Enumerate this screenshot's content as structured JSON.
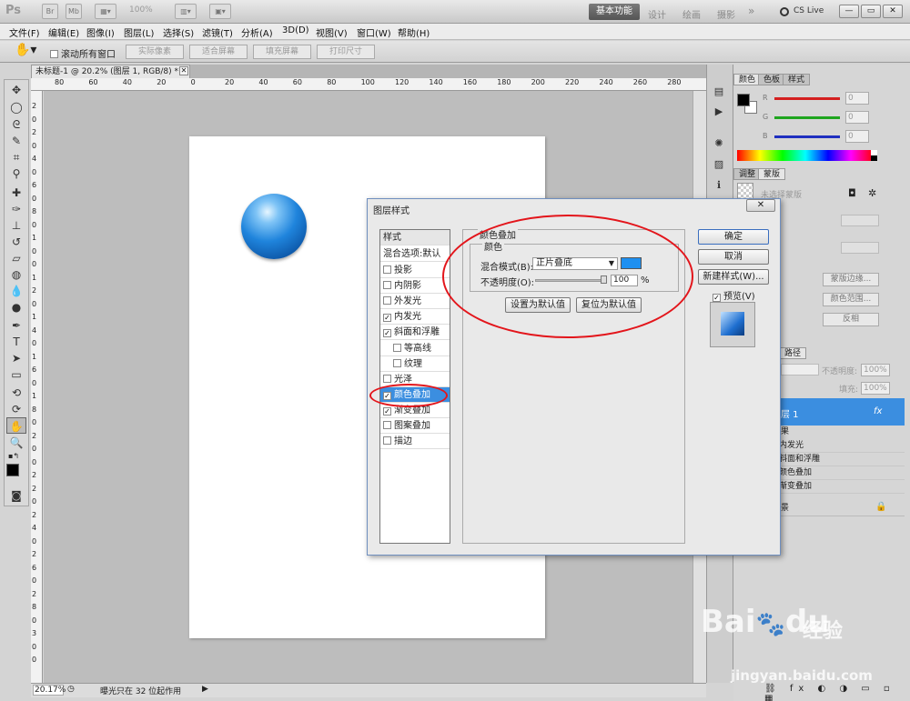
{
  "app": {
    "logo": "Ps",
    "bridge_icon": "Br",
    "minibridge_icon": "Mb",
    "zoom": "100%",
    "workspaces": [
      "基本功能",
      "设计",
      "绘画",
      "摄影"
    ],
    "more": "»",
    "cs_live": "CS Live",
    "window_buttons": [
      "—",
      "▭",
      "✕"
    ]
  },
  "menu": [
    "文件(F)",
    "编辑(E)",
    "图像(I)",
    "图层(L)",
    "选择(S)",
    "滤镜(T)",
    "分析(A)",
    "3D(D)",
    "视图(V)",
    "窗口(W)",
    "帮助(H)"
  ],
  "options_bar": {
    "scroll_all": "滚动所有窗口",
    "buttons": [
      "实际像素",
      "适合屏幕",
      "填充屏幕",
      "打印尺寸"
    ]
  },
  "document": {
    "tab_title": "未标题-1 @ 20.2% (图层 1, RGB/8) *",
    "ruler_top": [
      "80",
      "60",
      "40",
      "20",
      "0",
      "20",
      "40",
      "60",
      "80",
      "100",
      "120",
      "140",
      "160",
      "180",
      "200",
      "220",
      "240",
      "260",
      "280"
    ],
    "ruler_left": [
      "2",
      "0",
      "2",
      "0",
      "4",
      "0",
      "6",
      "0",
      "8",
      "0",
      "1",
      "0",
      "0",
      "1",
      "2",
      "0",
      "1",
      "4",
      "0",
      "1",
      "6",
      "0",
      "1",
      "8",
      "0",
      "2",
      "0",
      "0",
      "2",
      "2",
      "0",
      "2",
      "4",
      "0",
      "2",
      "6",
      "0",
      "2",
      "8",
      "0",
      "3",
      "0",
      "0"
    ]
  },
  "status": {
    "zoom": "20.17%",
    "info": "曝光只在 32 位起作用"
  },
  "color_panel": {
    "tabs": [
      "颜色",
      "色板",
      "样式"
    ],
    "channels": [
      {
        "label": "R",
        "value": "0",
        "color": "#d42020"
      },
      {
        "label": "G",
        "value": "0",
        "color": "#1fa51f"
      },
      {
        "label": "B",
        "value": "0",
        "color": "#1f2fbf"
      }
    ]
  },
  "adjust_panel": {
    "tabs": [
      "调整",
      "蒙版"
    ],
    "no_mask": "未选择蒙版",
    "buttons": [
      "蒙版边缘...",
      "颜色范围...",
      "反相"
    ]
  },
  "layers_panel": {
    "tab": "路径",
    "opacity_label": "不透明度:",
    "opacity_value": "100%",
    "fill_label": "填充:",
    "fill_value": "100%",
    "selected_layer": "层 1",
    "fx": "fx",
    "effects_label": "果",
    "effects": [
      "内发光",
      "斜面和浮雕",
      "颜色叠加",
      "渐变叠加"
    ],
    "background": "景"
  },
  "dialog": {
    "title": "图层样式",
    "close": "✕",
    "styles_header": "样式",
    "blend_default": "混合选项:默认",
    "items": [
      {
        "label": "投影",
        "checked": false,
        "sub": false,
        "selected": false
      },
      {
        "label": "内阴影",
        "checked": false,
        "sub": false,
        "selected": false
      },
      {
        "label": "外发光",
        "checked": false,
        "sub": false,
        "selected": false
      },
      {
        "label": "内发光",
        "checked": true,
        "sub": false,
        "selected": false
      },
      {
        "label": "斜面和浮雕",
        "checked": true,
        "sub": false,
        "selected": false
      },
      {
        "label": "等高线",
        "checked": false,
        "sub": true,
        "selected": false
      },
      {
        "label": "纹理",
        "checked": false,
        "sub": true,
        "selected": false
      },
      {
        "label": "光泽",
        "checked": false,
        "sub": false,
        "selected": false
      },
      {
        "label": "颜色叠加",
        "checked": true,
        "sub": false,
        "selected": true
      },
      {
        "label": "渐变叠加",
        "checked": true,
        "sub": false,
        "selected": false
      },
      {
        "label": "图案叠加",
        "checked": false,
        "sub": false,
        "selected": false
      },
      {
        "label": "描边",
        "checked": false,
        "sub": false,
        "selected": false
      }
    ],
    "section_title": "颜色叠加",
    "group_title": "颜色",
    "blend_mode_label": "混合模式(B):",
    "blend_mode_value": "正片叠底",
    "overlay_color": "#1e90f0",
    "opacity_label": "不透明度(O):",
    "opacity_value": "100",
    "opacity_unit": "%",
    "set_default": "设置为默认值",
    "reset_default": "复位为默认值",
    "ok": "确定",
    "cancel": "取消",
    "new_style": "新建样式(W)...",
    "preview_label": "预览(V)",
    "preview_checked": true
  },
  "watermark": {
    "brand": "Bai",
    "brand2": "du",
    "cn": "经验",
    "url": "jingyan.baidu.com"
  }
}
